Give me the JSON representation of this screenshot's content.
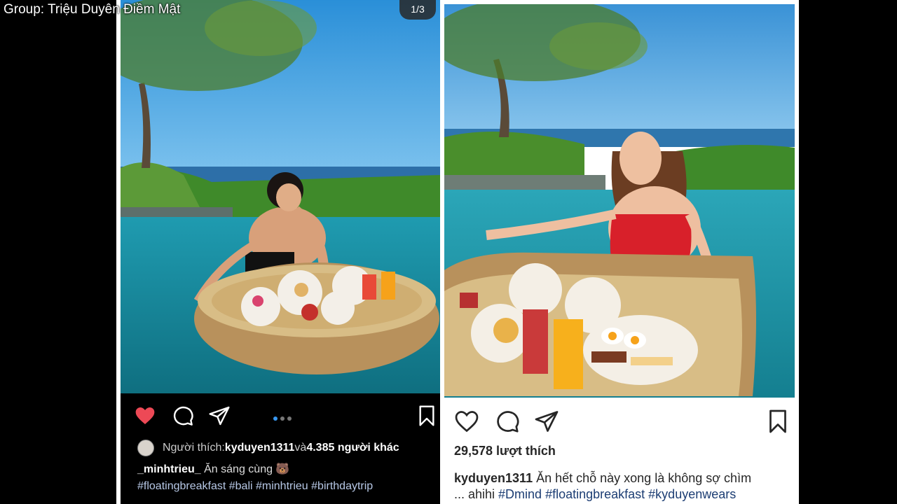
{
  "watermark": "Group: Triệu Duyên Điềm Mật",
  "left_post": {
    "image_counter": "1/3",
    "liked_by_prefix": "Người thích: ",
    "liked_by_user": "kyduyen1311",
    "liked_by_and": " và ",
    "liked_by_others": "4.385 người khác",
    "caption_user": "_minhtrieu_",
    "caption_text": " Ăn sáng cùng 🐻",
    "hashtags": "#floatingbreakfast #bali #minhtrieu #birthdaytrip",
    "heart_color": "#ed4956",
    "active_dot_color": "#3897f0"
  },
  "right_post": {
    "likes": "29,578 lượt thích",
    "caption_user": "kyduyen1311",
    "caption_text": " Ăn hết chỗ này xong là không sợ chìm",
    "caption_more": "... ahihi ",
    "hashtags": "#Dmind #floatingbreakfast #kyduyenwears"
  },
  "icons": [
    "heart-icon",
    "comment-icon",
    "share-icon",
    "bookmark-icon",
    "carousel-dots"
  ]
}
